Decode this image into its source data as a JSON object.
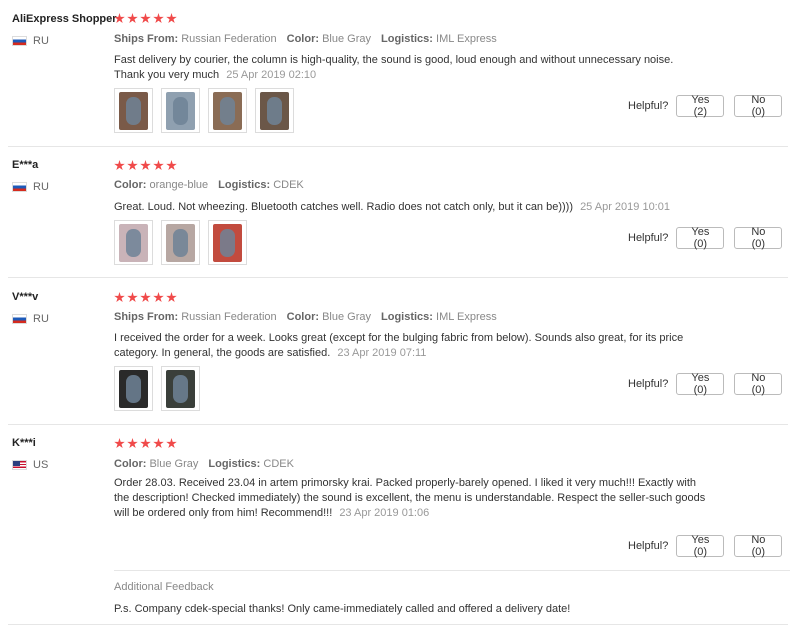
{
  "helpful_label": "Helpful?",
  "star_count": 5,
  "colors": {
    "star": "#f04a4a",
    "divider": "#e6e6e6"
  },
  "reviews": [
    {
      "user": "AliExpress Shopper",
      "country": "RU",
      "attributes": [
        {
          "key": "Ships From:",
          "value": "Russian Federation"
        },
        {
          "key": "Color:",
          "value": "Blue Gray"
        },
        {
          "key": "Logistics:",
          "value": "IML Express"
        }
      ],
      "text": "Fast delivery by courier, the column is high-quality, the sound is good, loud enough and without unnecessary noise. Thank you very much",
      "date": "25 Apr 2019 02:10",
      "photo_count": 4,
      "yes_label": "Yes (2)",
      "no_label": "No (0)"
    },
    {
      "user": "E***a",
      "country": "RU",
      "attributes": [
        {
          "key": "Color:",
          "value": "orange-blue"
        },
        {
          "key": "Logistics:",
          "value": "CDEK"
        }
      ],
      "text": "Great. Loud. Not wheezing. Bluetooth catches well. Radio does not catch only, but it can be))))",
      "date": "25 Apr 2019 10:01",
      "photo_count": 3,
      "yes_label": "Yes (0)",
      "no_label": "No (0)"
    },
    {
      "user": "V***v",
      "country": "RU",
      "attributes": [
        {
          "key": "Ships From:",
          "value": "Russian Federation"
        },
        {
          "key": "Color:",
          "value": "Blue Gray"
        },
        {
          "key": "Logistics:",
          "value": "IML Express"
        }
      ],
      "text": "I received the order for a week. Looks great (except for the bulging fabric from below). Sounds also great, for its price category. In general, the goods are satisfied.",
      "date": "23 Apr 2019 07:11",
      "photo_count": 2,
      "yes_label": "Yes (0)",
      "no_label": "No (0)"
    },
    {
      "user": "K***i",
      "country": "US",
      "attributes": [
        {
          "key": "Color:",
          "value": "Blue Gray"
        },
        {
          "key": "Logistics:",
          "value": "CDEK"
        }
      ],
      "text": "Order 28.03. Received 23.04 in artem primorsky krai. Packed properly-barely opened. I liked it very much!!! Exactly with the description! Checked immediately) the sound is excellent, the menu is understandable. Respect the seller-such goods will be ordered only from him! Recommend!!!",
      "date": "23 Apr 2019 01:06",
      "photo_count": 0,
      "yes_label": "Yes (0)",
      "no_label": "No (0)",
      "additional_title": "Additional Feedback",
      "additional_text": "P.s. Company cdek-special thanks! Only came-immediately called and offered a delivery date!"
    }
  ]
}
